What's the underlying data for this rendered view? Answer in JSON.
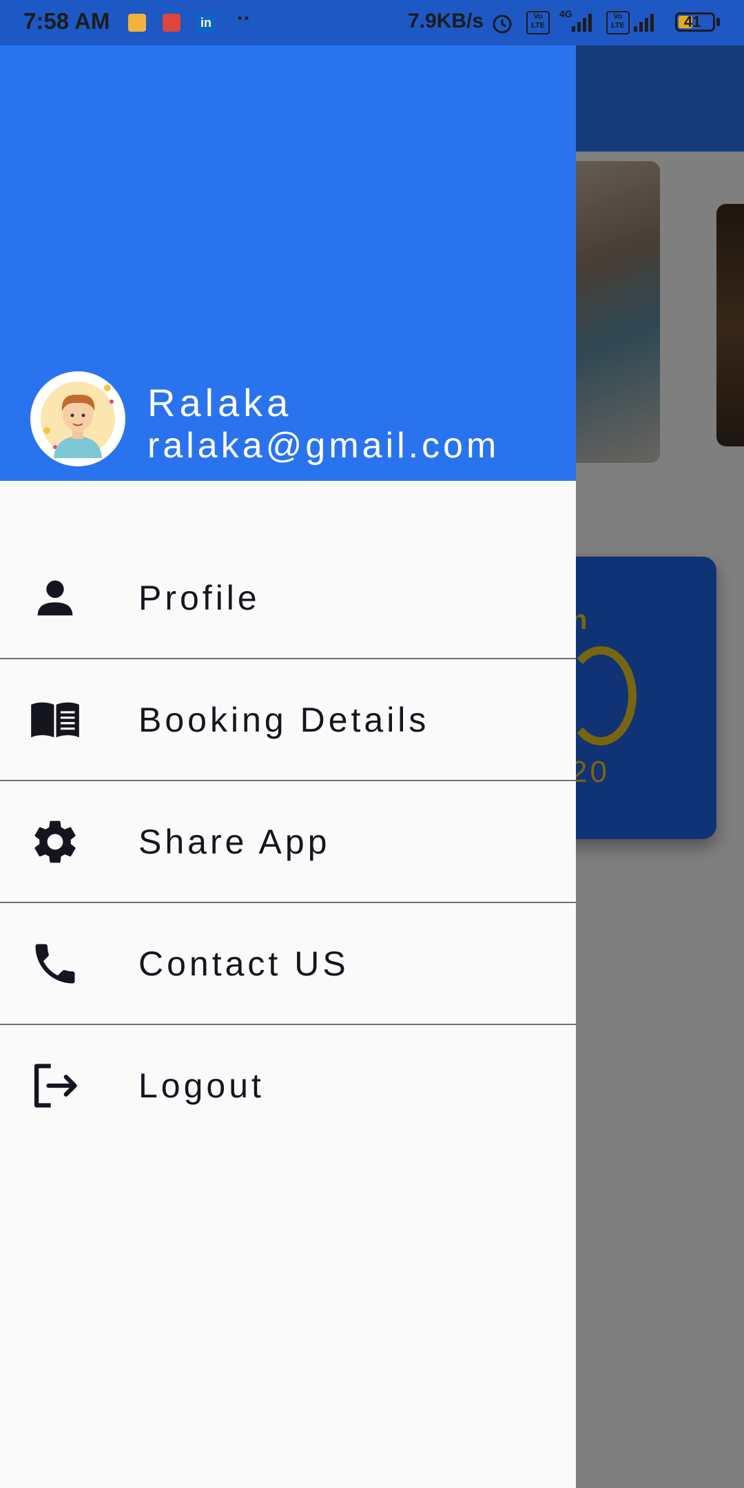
{
  "status_bar": {
    "time": "7:58 AM",
    "network_speed": "7.9KB/s",
    "network_type": "4G",
    "battery_level": "41",
    "battery_percent": 41,
    "notification_icons": [
      "notes-icon",
      "calendar-app-icon",
      "linkedin-icon",
      "more-dots-icon"
    ],
    "system_icons": [
      "alarm-icon",
      "volte-icon",
      "signal-icon",
      "volte-icon",
      "signal-icon",
      "battery-icon"
    ]
  },
  "drawer": {
    "header_color": "#2a73ee",
    "user": {
      "name": "Ralaka",
      "email": "ralaka@gmail.com",
      "avatar": "user-avatar-illustration"
    },
    "menu": [
      {
        "label": "Profile",
        "icon": "person-icon"
      },
      {
        "label": "Booking Details",
        "icon": "book-icon"
      },
      {
        "label": "Share App",
        "icon": "gear-icon"
      },
      {
        "label": "Contact US",
        "icon": "phone-icon"
      },
      {
        "label": "Logout",
        "icon": "logout-icon"
      }
    ]
  },
  "background_app": {
    "promo_partial_text_1": "n",
    "promo_partial_text_2": "20",
    "appbar_color": "#2a6fe8"
  }
}
